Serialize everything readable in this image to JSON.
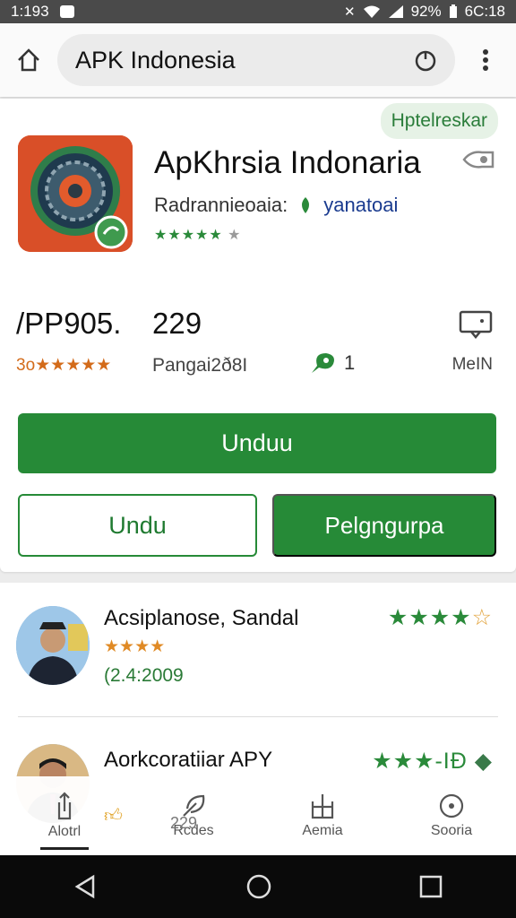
{
  "status_bar": {
    "time": "1:193",
    "battery": "92%",
    "clock_right": "6C:18"
  },
  "browser": {
    "url_text": "APK Indonesia"
  },
  "app": {
    "tag": "Hptelreskar",
    "title": "ApKhrsia Indonaria",
    "developer_label": "Radrannieoaia:",
    "developer_name": "yanatoai",
    "stars": "★★★★★",
    "stars_dim": "★",
    "stat1_value": "/PP905.",
    "stat1_sub": "3o★★★★★",
    "stat2_value": "229",
    "stat2_sub": "Pangai2ð8I",
    "stat3_value": "1",
    "stat4_label": "MeIN",
    "accent": "#268a37"
  },
  "buttons": {
    "primary": "Unduu",
    "outline": "Undu",
    "secondary": "Pelgngurpa"
  },
  "reviews": [
    {
      "name": "Acsiplanose, Sandal",
      "stars": "★★★★",
      "stars_half": "☆",
      "sub_stars": "★★★★",
      "date": "(2.4:2009"
    },
    {
      "name": "Aorkcoratiiar APY",
      "stars": "★★★-IĐ",
      "stars_half": "",
      "sub_stars": "",
      "date": ""
    }
  ],
  "overlay": {
    "count": "229"
  },
  "bottom_nav": [
    {
      "label": "Alotrl",
      "icon": "share-icon"
    },
    {
      "label": "Rcdes",
      "icon": "feather-icon"
    },
    {
      "label": "Aemia",
      "icon": "grid-icon"
    },
    {
      "label": "Sooria",
      "icon": "circle-icon"
    }
  ]
}
